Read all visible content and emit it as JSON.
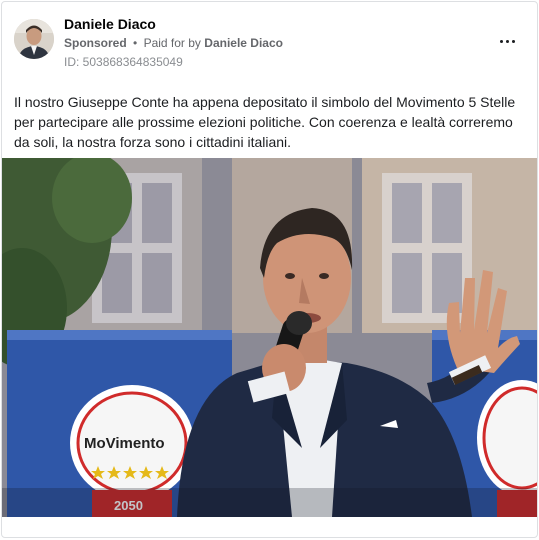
{
  "post": {
    "page_name": "Daniele Diaco",
    "sponsored_label": "Sponsored",
    "separator": "•",
    "paid_for_prefix": "Paid for by",
    "paid_for_name": "Daniele Diaco",
    "ad_id": "ID: 503868364835049",
    "body_text": "Il nostro Giuseppe Conte ha appena depositato il simbolo del Movimento 5 Stelle per partecipare alle prossime elezioni politiche. Con coerenza e lealtà correremo da soli, la nostra forza sono i cittadini italiani."
  },
  "image": {
    "banner_text": "MoVimento",
    "banner_year": "2050"
  },
  "icons": {
    "more": "more-horizontal-icon",
    "avatar": "profile-photo"
  },
  "colors": {
    "name_text": "#050505",
    "meta_text": "#65676b",
    "id_text": "#8a8d91",
    "body_text": "#1c1e21",
    "card_border": "#dddfe2"
  }
}
